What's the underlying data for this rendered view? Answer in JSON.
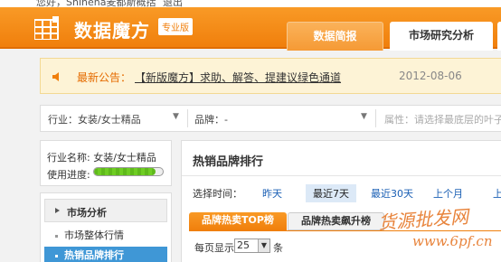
{
  "topbar": {
    "user_text": "您好，Shinena麦都斯概括",
    "logout_text": "退出"
  },
  "header": {
    "brand": "数据魔方",
    "edition_badge": "专业版",
    "tabs": [
      {
        "label": "数据简报",
        "active": false
      },
      {
        "label": "市场研究分析",
        "active": true
      }
    ],
    "accent_color": "#f07f0c"
  },
  "notice": {
    "label": "最新公告：",
    "link_text": "【新版魔方】求助、解答、提建议绿色通道",
    "date": "2012-08-06"
  },
  "filters": {
    "industry": "行业：女装/女士精品",
    "brand": "品牌：-",
    "attribute": "属性：请选择最底层的叶子行"
  },
  "sidebar": {
    "industry_name": "行业名称: 女装/女士精品",
    "progress_label": "使用进度:",
    "progress_value": 0.9,
    "menu_title": "市场分析",
    "items": [
      {
        "label": "市场整体行情",
        "active": false
      },
      {
        "label": "热销品牌排行",
        "active": true
      }
    ],
    "active_color": "#3f97d6"
  },
  "main": {
    "title": "热销品牌排行",
    "time_label": "选择时间：",
    "time_options": [
      "昨天",
      "最近7天",
      "最近30天",
      "上个月",
      "上"
    ],
    "selected_time": "最近7天",
    "subtabs": [
      "品牌热卖TOP榜",
      "品牌热卖飙升榜"
    ],
    "per_page_label": "每页显示",
    "per_page_value": "25",
    "per_page_unit": "条"
  },
  "watermark": {
    "line1": "货源批发网",
    "line2": "www.6pf.cn"
  }
}
